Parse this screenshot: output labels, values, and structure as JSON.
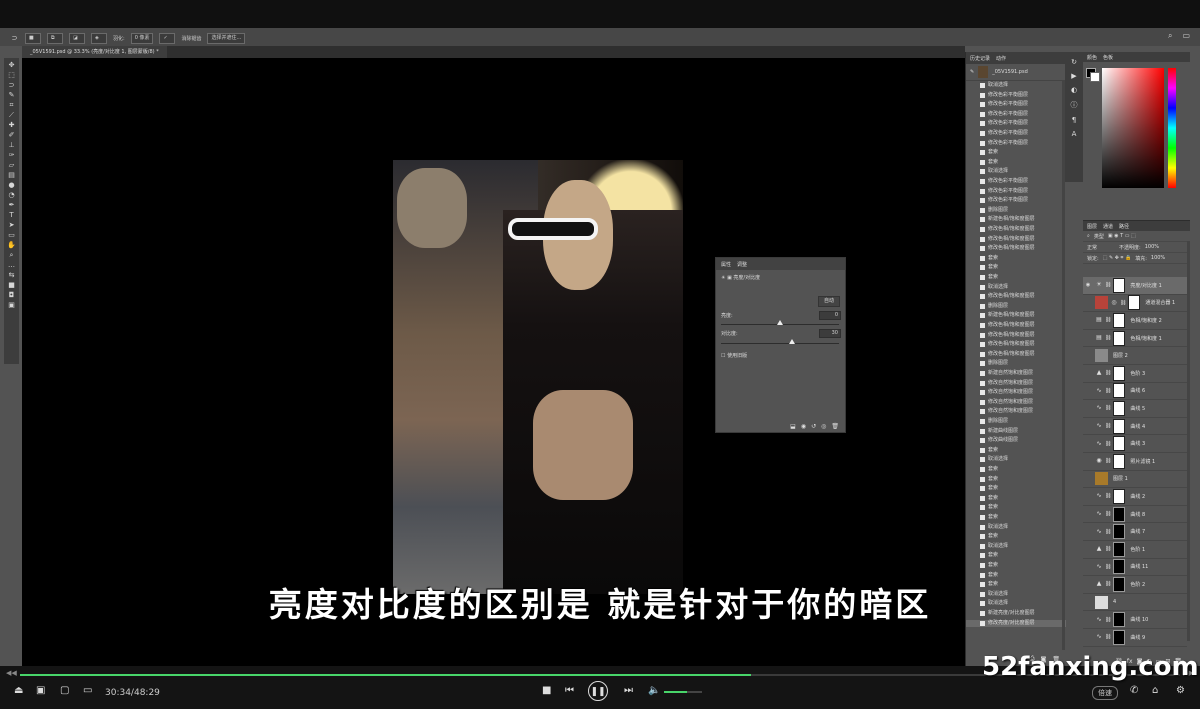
{
  "options_bar": {
    "feather_label": "羽化:",
    "feather_value": "0 像素",
    "antialias_label": "消除锯齿",
    "select_mask_label": "选择并遮住..."
  },
  "document_tab": {
    "title": "_05V1591.psd @ 33.3% (亮度/对比度 1, 图层蒙版/8) *"
  },
  "properties": {
    "tabs": [
      "属性",
      "调整"
    ],
    "adjust_name": "亮度/对比度",
    "auto_label": "自动",
    "brightness_label": "亮度:",
    "brightness_value": "0",
    "brightness_norm": 0.5,
    "contrast_label": "对比度:",
    "contrast_value": "30",
    "contrast_norm": 0.6,
    "legacy_label": "使用旧版"
  },
  "history": {
    "tabs": [
      "历史记录",
      "动作"
    ],
    "snapshot": "_05V1591.psd",
    "items": [
      "取消选择",
      "修改色彩平衡图层",
      "修改色彩平衡图层",
      "修改色彩平衡图层",
      "修改色彩平衡图层",
      "修改色彩平衡图层",
      "修改色彩平衡图层",
      "套索",
      "套索",
      "取消选择",
      "修改色彩平衡图层",
      "修改色彩平衡图层",
      "修改色彩平衡图层",
      "删除图层",
      "新建色相/饱和度图层",
      "修改色相/饱和度图层",
      "修改色相/饱和度图层",
      "修改色相/饱和度图层",
      "套索",
      "套索",
      "套索",
      "取消选择",
      "修改色相/饱和度图层",
      "删除图层",
      "新建色相/饱和度图层",
      "修改色相/饱和度图层",
      "修改色相/饱和度图层",
      "修改色相/饱和度图层",
      "修改色相/饱和度图层",
      "删除图层",
      "新建自然饱和度图层",
      "修改自然饱和度图层",
      "修改自然饱和度图层",
      "修改自然饱和度图层",
      "修改自然饱和度图层",
      "删除图层",
      "新建曲线图层",
      "修改曲线图层",
      "套索",
      "取消选择",
      "套索",
      "套索",
      "套索",
      "套索",
      "套索",
      "套索",
      "取消选择",
      "套索",
      "取消选择",
      "套索",
      "套索",
      "套索",
      "套索",
      "取消选择",
      "取消选择",
      "新建亮度/对比度图层",
      "修改亮度/对比度图层"
    ],
    "selected_index": 56
  },
  "color_panel": {
    "tabs": [
      "颜色",
      "色板"
    ]
  },
  "layers": {
    "tabs": [
      "图层",
      "通道",
      "路径"
    ],
    "kind_label": "类型",
    "blend_mode": "正常",
    "opacity_label": "不透明度:",
    "opacity_value": "100%",
    "lock_label": "锁定:",
    "fill_label": "填充:",
    "fill_value": "100%",
    "items": [
      {
        "name": "亮度/对比度 1",
        "icon": "sun-icon",
        "mask": "white",
        "selected": true,
        "visible": true
      },
      {
        "name": "通道混合器 1",
        "icon": "mixer-icon",
        "mask": "white",
        "selected": false,
        "visible": false,
        "thumb_color": "#b8433a"
      },
      {
        "name": "色相/饱和度 2",
        "icon": "hue-icon",
        "mask": "white",
        "selected": false,
        "visible": false
      },
      {
        "name": "色相/饱和度 1",
        "icon": "hue-icon",
        "mask": "white",
        "selected": false,
        "visible": false
      },
      {
        "name": "图层 2",
        "icon": "",
        "mask": "",
        "selected": false,
        "visible": false,
        "thumb_color": "#8a8a8a"
      },
      {
        "name": "色阶 3",
        "icon": "levels-icon",
        "mask": "white",
        "selected": false,
        "visible": false
      },
      {
        "name": "曲线 6",
        "icon": "curves-icon",
        "mask": "white",
        "selected": false,
        "visible": false
      },
      {
        "name": "曲线 5",
        "icon": "curves-icon",
        "mask": "white",
        "selected": false,
        "visible": false
      },
      {
        "name": "曲线 4",
        "icon": "curves-icon",
        "mask": "white",
        "selected": false,
        "visible": false
      },
      {
        "name": "曲线 3",
        "icon": "curves-icon",
        "mask": "white",
        "selected": false,
        "visible": false
      },
      {
        "name": "照片滤镜 1",
        "icon": "filter-icon",
        "mask": "white",
        "selected": false,
        "visible": false
      },
      {
        "name": "图层 1",
        "icon": "",
        "mask": "",
        "selected": false,
        "visible": false,
        "thumb_color": "#a87a2a"
      },
      {
        "name": "曲线 2",
        "icon": "curves-icon",
        "mask": "white",
        "selected": false,
        "visible": false
      },
      {
        "name": "曲线 8",
        "icon": "curves-icon",
        "mask": "dark",
        "selected": false,
        "visible": false
      },
      {
        "name": "曲线 7",
        "icon": "curves-icon",
        "mask": "dark",
        "selected": false,
        "visible": false
      },
      {
        "name": "色阶 1",
        "icon": "levels-icon",
        "mask": "dark",
        "selected": false,
        "visible": false
      },
      {
        "name": "曲线 11",
        "icon": "curves-icon",
        "mask": "dark",
        "selected": false,
        "visible": false
      },
      {
        "name": "色阶 2",
        "icon": "levels-icon",
        "mask": "dark",
        "selected": false,
        "visible": false
      },
      {
        "name": "4",
        "icon": "",
        "mask": "",
        "selected": false,
        "visible": false,
        "thumb_color": "#dddddd"
      },
      {
        "name": "曲线 10",
        "icon": "curves-icon",
        "mask": "dark",
        "selected": false,
        "visible": false
      },
      {
        "name": "曲线 9",
        "icon": "curves-icon",
        "mask": "dark",
        "selected": false,
        "visible": false
      }
    ]
  },
  "subtitle": "亮度对比度的区别是 就是针对于你的暗区",
  "player": {
    "time": "30:34/48:29",
    "progress": 0.63,
    "volume": 0.6,
    "speed_label": "倍速"
  },
  "watermark": "52fanxing.com",
  "colors": {
    "accent_green": "#48d56a",
    "panel": "#535353",
    "panel_dark": "#3d3d3d"
  }
}
